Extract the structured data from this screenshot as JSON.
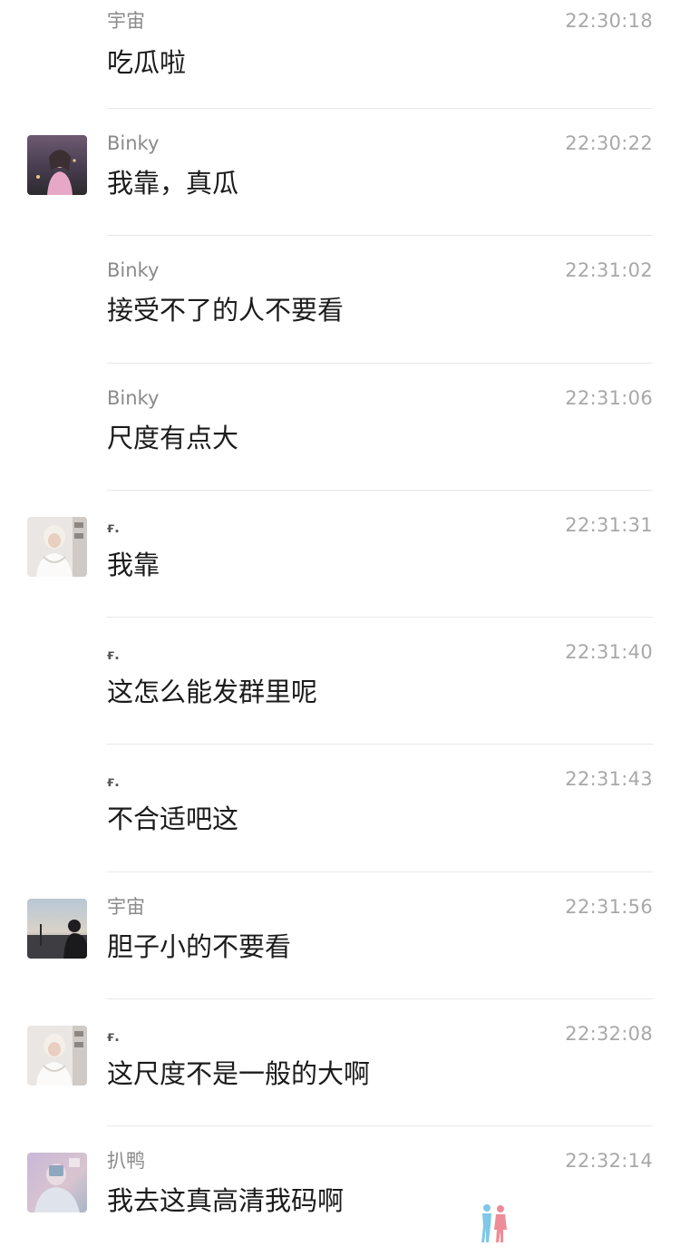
{
  "messages": [
    {
      "sender": "宇宙",
      "time": "22:30:18",
      "text": "吃瓜啦",
      "avatar": "none"
    },
    {
      "sender": "Binky",
      "time": "22:30:22",
      "text": "我靠，真瓜",
      "avatar": "binky-avatar"
    },
    {
      "sender": "Binky",
      "time": "22:31:02",
      "text": "接受不了的人不要看",
      "avatar": "none"
    },
    {
      "sender": "Binky",
      "time": "22:31:06",
      "text": "尺度有点大",
      "avatar": "none"
    },
    {
      "sender": "ғ.",
      "time": "22:31:31",
      "text": "我靠",
      "avatar": "f-avatar"
    },
    {
      "sender": "ғ.",
      "time": "22:31:40",
      "text": "这怎么能发群里呢",
      "avatar": "none"
    },
    {
      "sender": "ғ.",
      "time": "22:31:43",
      "text": "不合适吧这",
      "avatar": "none"
    },
    {
      "sender": "宇宙",
      "time": "22:31:56",
      "text": "胆子小的不要看",
      "avatar": "yuzhou-avatar"
    },
    {
      "sender": "ғ.",
      "time": "22:32:08",
      "text": "这尺度不是一般的大啊",
      "avatar": "f-avatar"
    },
    {
      "sender": "扒鸭",
      "time": "22:32:14",
      "text": "我去这真高清我码啊",
      "avatar": "baya-avatar"
    }
  ],
  "colors": {
    "sender": "#8a8a8a",
    "timestamp": "#a8a8a8",
    "text": "#1b1b1b",
    "divider": "#e8e8e8"
  },
  "icons": {
    "watermark": "couple-silhouette-icon"
  }
}
